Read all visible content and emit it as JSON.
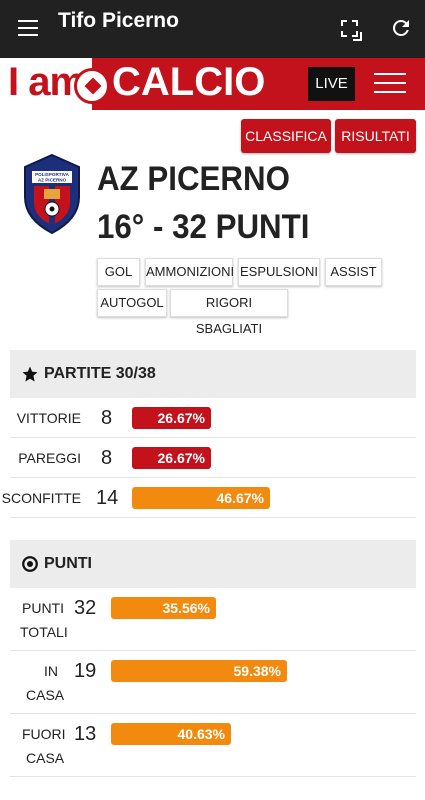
{
  "appbar": {
    "title": "Tifo Picerno"
  },
  "brand": {
    "logo_left": "I am",
    "logo_right": "CALCIO",
    "live_label": "LIVE"
  },
  "buttons": {
    "classifica": "CLASSIFICA",
    "risultati": "RISULTATI"
  },
  "team": {
    "crest_text": [
      "POLISPORTIVA",
      "AZ PICERNO"
    ],
    "name": "AZ PICERNO",
    "rank": "16° - 32 PUNTI"
  },
  "chips": [
    "GOL",
    "AMMONIZIONI",
    "ESPULSIONI",
    "ASSIST",
    "AUTOGOL",
    "RIGORI SBAGLIATI"
  ],
  "partite": {
    "title": "PARTITE 30/38",
    "rows": [
      {
        "label": "VITTORIE",
        "value": "8",
        "pct": "26.67%",
        "fraction": 0.2667,
        "color": "#c4121c"
      },
      {
        "label": "PAREGGI",
        "value": "8",
        "pct": "26.67%",
        "fraction": 0.2667,
        "color": "#c4121c"
      },
      {
        "label": "SCONFITTE",
        "value": "14",
        "pct": "46.67%",
        "fraction": 0.4667,
        "color": "#f28a10"
      }
    ]
  },
  "punti": {
    "title": "PUNTI",
    "rows": [
      {
        "label1": "PUNTI",
        "label2": "TOTALI",
        "value": "32",
        "pct": "35.56%",
        "fraction": 0.3556
      },
      {
        "label1": "IN",
        "label2": "CASA",
        "value": "19",
        "pct": "59.38%",
        "fraction": 0.5938
      },
      {
        "label1": "FUORI",
        "label2": "CASA",
        "value": "13",
        "pct": "40.63%",
        "fraction": 0.4063
      }
    ]
  }
}
